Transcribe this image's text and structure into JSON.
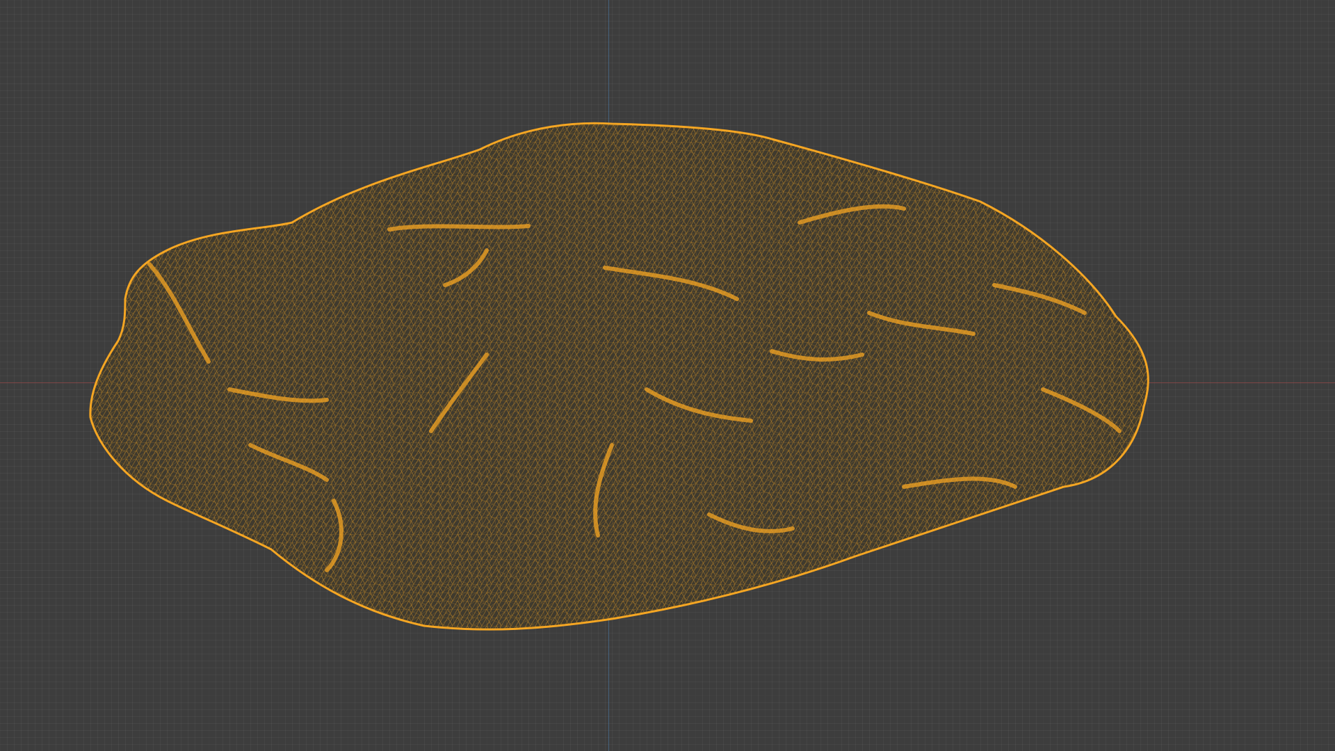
{
  "viewport": {
    "background_color": "#3d3d3d",
    "grid": true,
    "axis_x_color": "#b04545",
    "axis_y_color": "#4e7fb0"
  },
  "object": {
    "display_mode": "wireframe",
    "wire_color": "#f5a623",
    "dark_fill": "#3f3a2e"
  }
}
